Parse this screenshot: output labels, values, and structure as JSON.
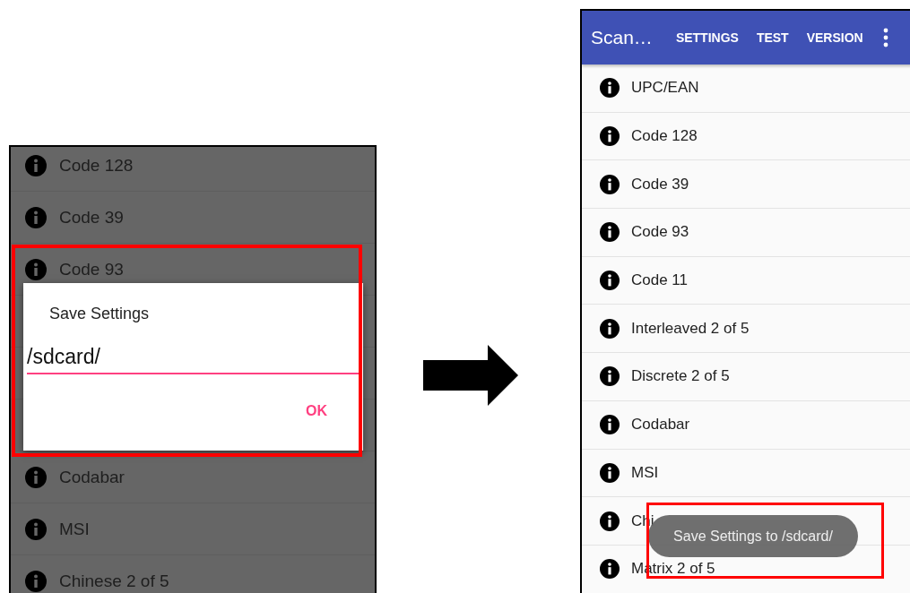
{
  "left_screen": {
    "items_above": [
      "Code 128",
      "Code 39",
      "Code 93"
    ],
    "items_below": [
      "Codabar",
      "MSI",
      "Chinese 2 of 5"
    ],
    "dialog": {
      "title": "Save Settings",
      "field_value": "/sdcard/",
      "button": "OK"
    }
  },
  "right_screen": {
    "app_bar": {
      "title": "Scan…",
      "actions": [
        "SETTINGS",
        "TEST",
        "VERSION"
      ]
    },
    "list_items": [
      "UPC/EAN",
      "Code 128",
      "Code 39",
      "Code 93",
      "Code 11",
      "Interleaved 2 of 5",
      "Discrete 2 of 5",
      "Codabar",
      "MSI",
      "Chi",
      "Matrix 2 of 5"
    ],
    "toast": "Save Settings to /sdcard/"
  }
}
